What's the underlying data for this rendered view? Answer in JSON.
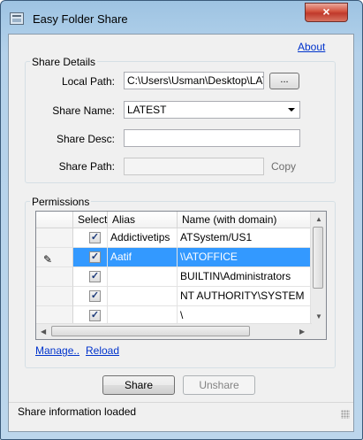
{
  "window": {
    "title": "Easy Folder Share",
    "close_symbol": "×"
  },
  "about_link": "About",
  "share_details": {
    "legend": "Share Details",
    "local_path_label": "Local Path:",
    "local_path_value": "C:\\Users\\Usman\\Desktop\\LATEST",
    "browse_label": "...",
    "share_name_label": "Share Name:",
    "share_name_value": "LATEST",
    "share_desc_label": "Share Desc:",
    "share_desc_value": "",
    "share_path_label": "Share Path:",
    "share_path_value": "",
    "copy_label": "Copy"
  },
  "permissions": {
    "legend": "Permissions",
    "columns": [
      "Select",
      "Alias",
      "Name (with domain)"
    ],
    "rows": [
      {
        "checked": true,
        "alias": "Addictivetips",
        "name": "ATSystem/US1",
        "selected": false,
        "editing": false
      },
      {
        "checked": true,
        "alias": "Aatif",
        "name": "\\\\ATOFFICE",
        "selected": true,
        "editing": true
      },
      {
        "checked": true,
        "alias": "",
        "name": "BUILTIN\\Administrators",
        "selected": false,
        "editing": false
      },
      {
        "checked": true,
        "alias": "",
        "name": "NT AUTHORITY\\SYSTEM",
        "selected": false,
        "editing": false
      },
      {
        "checked": true,
        "alias": "",
        "name": "\\",
        "selected": false,
        "editing": false
      }
    ],
    "manage_link": "Manage..",
    "reload_link": "Reload"
  },
  "buttons": {
    "share": "Share",
    "unshare": "Unshare"
  },
  "status": {
    "text": "Share information loaded"
  }
}
